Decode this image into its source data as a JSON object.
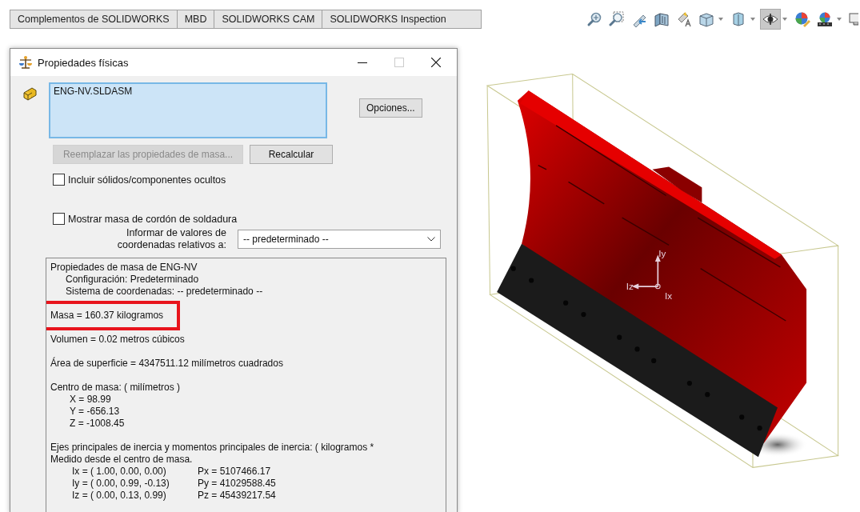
{
  "tabs": [
    {
      "label": "Complementos de SOLIDWORKS",
      "selected": false
    },
    {
      "label": "MBD",
      "selected": false
    },
    {
      "label": "SOLIDWORKS CAM",
      "selected": false
    },
    {
      "label": "SOLIDWORKS Inspection",
      "selected": false
    }
  ],
  "toolbar": [
    {
      "kind": "zoomfit",
      "selected": false,
      "menu": false
    },
    {
      "kind": "zoomarea",
      "selected": false,
      "menu": false
    },
    {
      "kind": "previous",
      "selected": false,
      "menu": false
    },
    {
      "kind": "section",
      "selected": false,
      "menu": false
    },
    {
      "kind": "annotation",
      "selected": false,
      "menu": false
    },
    {
      "kind": "orientation",
      "selected": false,
      "menu": true
    },
    {
      "kind": "display",
      "selected": false,
      "menu": true
    },
    {
      "kind": "hideshow",
      "selected": true,
      "menu": true
    },
    {
      "kind": "appearance",
      "selected": false,
      "menu": false
    },
    {
      "kind": "scene",
      "selected": false,
      "menu": true
    },
    {
      "kind": "monitor",
      "selected": false,
      "menu": false
    }
  ],
  "dialog": {
    "title": "Propiedades físicas",
    "selection": "ENG-NV.SLDASM",
    "buttons": [
      {
        "label": "Opciones...",
        "disabled": false
      },
      {
        "label": "Reemplazar las propiedades de masa...",
        "disabled": true
      },
      {
        "label": "Recalcular",
        "disabled": false
      }
    ],
    "checkboxes": [
      {
        "label": "Incluir sólidos/componentes ocultos",
        "checked": false
      },
      {
        "label": "Mostrar masa de cordón de soldadura",
        "checked": false
      }
    ],
    "coordinates": {
      "label_lines": [
        "Informar de valores de",
        "coordenadas relativos a:"
      ],
      "value": "-- predeterminado --"
    },
    "results": [
      {
        "lines": [
          {
            "kind": "head",
            "text": "Propiedades de masa de ENG-NV",
            "highlighted": false
          },
          {
            "kind": "sub",
            "text": "Configuración:  Predeterminado",
            "highlighted": false
          },
          {
            "kind": "sub",
            "text": "Sistema de coordenadas:  -- predeterminado --",
            "highlighted": false
          }
        ]
      },
      {
        "lines": [
          {
            "kind": "head",
            "text": "Masa = 160.37 kilogramos",
            "highlighted": true
          }
        ]
      },
      {
        "lines": [
          {
            "kind": "head",
            "text": "Volumen = 0.02 metros cúbicos",
            "highlighted": false
          }
        ]
      },
      {
        "lines": [
          {
            "kind": "head",
            "text": "Área de superficie = 4347511.12  milímetros cuadrados",
            "highlighted": false
          }
        ]
      },
      {
        "lines": [
          {
            "kind": "head",
            "text": "Centro de masa: ( milímetros )",
            "highlighted": false
          },
          {
            "kind": "value",
            "text": "X = 98.99",
            "highlighted": false
          },
          {
            "kind": "value",
            "text": "Y = -656.13",
            "highlighted": false
          },
          {
            "kind": "value",
            "text": "Z = -1008.45",
            "highlighted": false
          }
        ]
      },
      {
        "lines": [
          {
            "kind": "head",
            "text": "Ejes principales de inercia y momentos principales de inercia: ( kilogramos *",
            "highlighted": false
          },
          {
            "kind": "head",
            "text": "Medido desde el centro de masa.",
            "highlighted": false
          },
          {
            "kind": "pair",
            "text": "Ix = ( 1.00,  0.00,  0.00)",
            "column_2": "Px = 5107466.17",
            "highlighted": false
          },
          {
            "kind": "pair",
            "text": "Iy = ( 0.00,  0.99, -0.13)",
            "column_2": "Py = 41029588.45",
            "highlighted": false
          },
          {
            "kind": "pair",
            "text": "Iz = ( 0.00,  0.13,  0.99)",
            "column_2": "Pz = 45439217.54",
            "highlighted": false
          }
        ]
      }
    ]
  },
  "viewport": {
    "axis_labels": [
      "Iy",
      "Iz",
      "Ix"
    ]
  }
}
